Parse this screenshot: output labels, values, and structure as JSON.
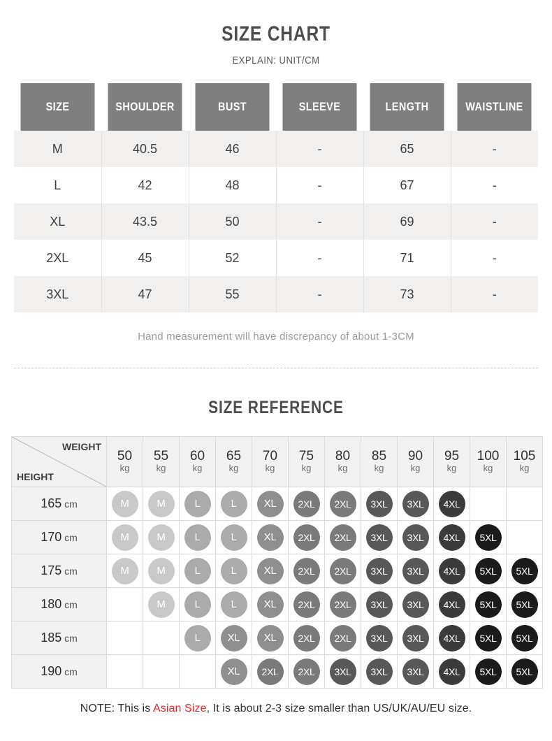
{
  "header": {
    "title": "SIZE CHART",
    "subtitle": "EXPLAIN: UNIT/CM"
  },
  "size_chart": {
    "columns": [
      "SIZE",
      "SHOULDER",
      "BUST",
      "SLEEVE",
      "LENGTH",
      "WAISTLINE"
    ],
    "rows": [
      [
        "M",
        "40.5",
        "46",
        "-",
        "65",
        "-"
      ],
      [
        "L",
        "42",
        "48",
        "-",
        "67",
        "-"
      ],
      [
        "XL",
        "43.5",
        "50",
        "-",
        "69",
        "-"
      ],
      [
        "2XL",
        "45",
        "52",
        "-",
        "71",
        "-"
      ],
      [
        "3XL",
        "47",
        "55",
        "-",
        "73",
        "-"
      ]
    ],
    "footnote": "Hand measurement will have discrepancy of about 1-3CM"
  },
  "size_reference": {
    "title": "SIZE REFERENCE",
    "weight_label": "WEIGHT",
    "height_label": "HEIGHT",
    "weight_unit": "kg",
    "height_unit": "cm",
    "weights": [
      "50",
      "55",
      "60",
      "65",
      "70",
      "75",
      "80",
      "85",
      "90",
      "95",
      "100",
      "105"
    ],
    "heights": [
      "165",
      "170",
      "175",
      "180",
      "185",
      "190"
    ],
    "grid": [
      [
        "M",
        "M",
        "L",
        "L",
        "XL",
        "2XL",
        "2XL",
        "3XL",
        "3XL",
        "4XL",
        "",
        ""
      ],
      [
        "M",
        "M",
        "L",
        "L",
        "XL",
        "2XL",
        "2XL",
        "3XL",
        "3XL",
        "4XL",
        "5XL",
        ""
      ],
      [
        "M",
        "M",
        "L",
        "L",
        "XL",
        "2XL",
        "2XL",
        "3XL",
        "3XL",
        "4XL",
        "5XL",
        "5XL"
      ],
      [
        "",
        "M",
        "L",
        "L",
        "XL",
        "2XL",
        "2XL",
        "3XL",
        "3XL",
        "4XL",
        "5XL",
        "5XL"
      ],
      [
        "",
        "",
        "L",
        "XL",
        "XL",
        "2XL",
        "2XL",
        "3XL",
        "3XL",
        "4XL",
        "5XL",
        "5XL"
      ],
      [
        "",
        "",
        "",
        "XL",
        "2XL",
        "2XL",
        "3XL",
        "3XL",
        "3XL",
        "4XL",
        "5XL",
        "5XL"
      ]
    ]
  },
  "bottom_note": {
    "prefix": "NOTE: This is ",
    "highlight": "Asian Size",
    "suffix": ", It is about 2-3 size smaller than US/UK/AU/EU size."
  },
  "colors": {
    "header_gray": "#7f7f7f",
    "row_shade": "#f2f0ee",
    "highlight_red": "#ee2222",
    "bubble_M": "#c9c9c9",
    "bubble_L": "#ababab",
    "bubble_XL": "#8f8f8f",
    "bubble_2XL": "#7a7a7a",
    "bubble_3XL": "#585858",
    "bubble_4XL": "#3b3b3b",
    "bubble_5XL": "#1b1b1b"
  }
}
